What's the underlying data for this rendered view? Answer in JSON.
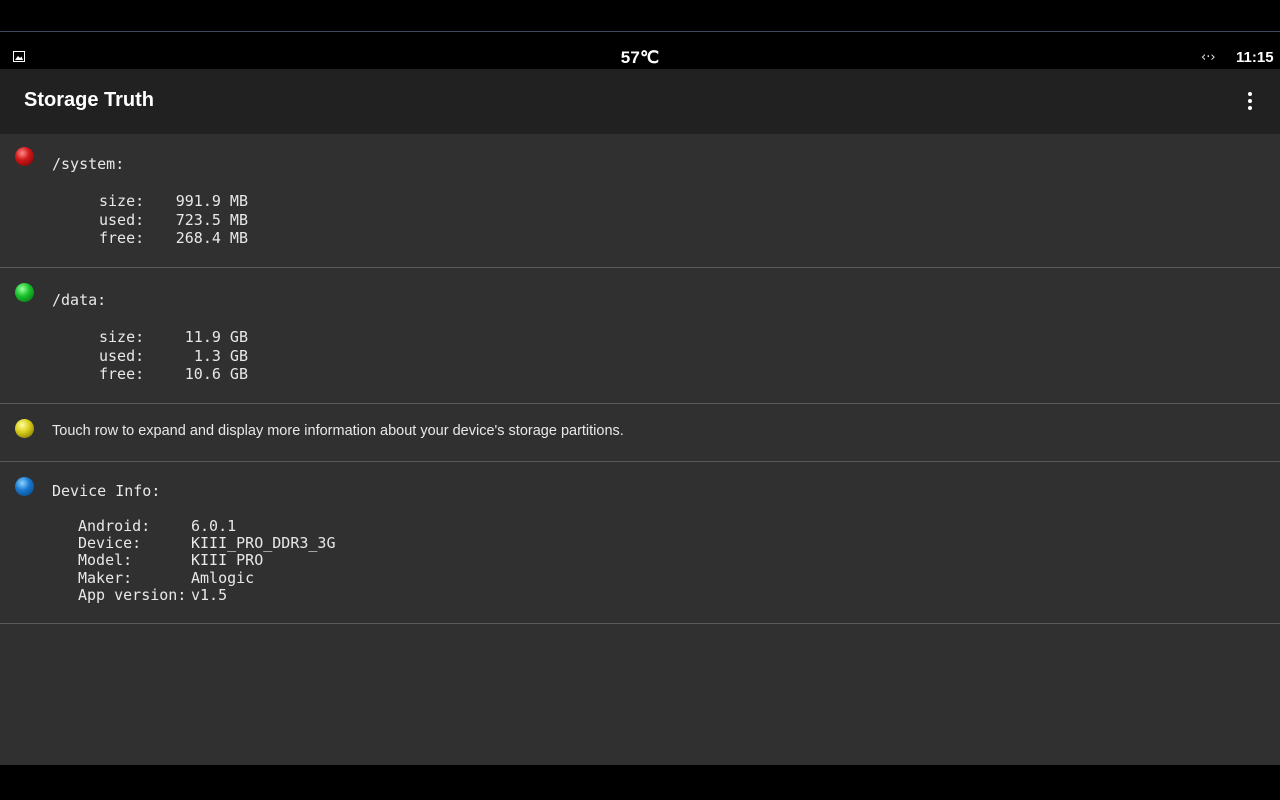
{
  "status_bar": {
    "gallery_icon": "image-icon",
    "temperature": "57℃",
    "network_icon": "‹·›",
    "time": "11:15"
  },
  "app_bar": {
    "title": "Storage Truth",
    "menu_icon": "more-vert-icon"
  },
  "partitions": [
    {
      "name": "/system:",
      "color": "#d01818",
      "size_label": "size:",
      "size": "991.9 MB",
      "used_label": "used:",
      "used": "723.5 MB",
      "free_label": "free:",
      "free": "268.4 MB"
    },
    {
      "name": "/data:",
      "color": "#18c22a",
      "size_label": "size:",
      "size": "11.9 GB",
      "used_label": "used:",
      "used": "1.3 GB",
      "free_label": "free:",
      "free": "10.6 GB"
    }
  ],
  "hint": {
    "color": "#d8cc1a",
    "text": "Touch row to expand and display more information about your device's storage partitions."
  },
  "device_info": {
    "color": "#1878d0",
    "title": "Device Info:",
    "rows": [
      {
        "label": "Android:",
        "value": "6.0.1"
      },
      {
        "label": "Device:",
        "value": "KIII_PRO_DDR3_3G"
      },
      {
        "label": "Model:",
        "value": "KIII PRO"
      },
      {
        "label": "Maker:",
        "value": "Amlogic"
      },
      {
        "label": "App version:",
        "value": "v1.5"
      }
    ]
  }
}
